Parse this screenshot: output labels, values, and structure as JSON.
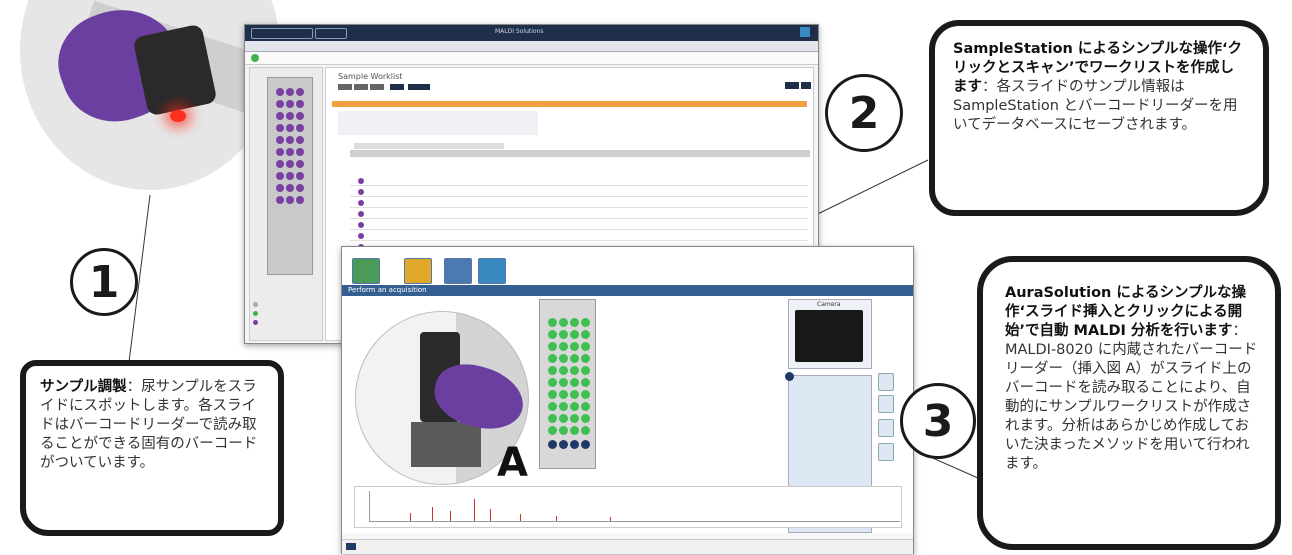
{
  "step_numbers": {
    "one": "1",
    "two": "2",
    "three": "3"
  },
  "inset_label": "A",
  "callout1": {
    "bold": "サンプル調製",
    "text": "：尿サンプルをスライドにスポットします。各スライドはバーコードリーダーで読み取ることができる固有のバーコードがついています。"
  },
  "callout2": {
    "bold": "SampleStation によるシンプルな操作‘クリックとスキャン’でワークリストを作成します",
    "text": "：各スライドのサンプル情報は SampleStation とバーコードリーダーを用いてデータベースにセーブされます。"
  },
  "callout3": {
    "bold": "AuraSolution によるシンプルな操作‘スライド挿入とクリックによる開始’で自動 MALDI 分析を行います",
    "text": "：MALDI-8020 に内蔵されたバーコードリーダー（挿入図 A）がスライド上のバーコードを読み取ることにより、自動的にサンプルワークリストが作成されます。分析はあらかじめ作成しておいた決まったメソッドを用いて行われます。"
  },
  "screen1": {
    "title": "MALDI Solutions",
    "panel_title": "Sample Worklist"
  },
  "screen2": {
    "header": "Perform an acquisition",
    "camera": "Camera"
  },
  "colors": {
    "purple": "#7a3fa0",
    "green": "#3fbf4f",
    "navy": "#1f3a66",
    "orange": "#f0a040",
    "outline": "#1a1a1a"
  }
}
